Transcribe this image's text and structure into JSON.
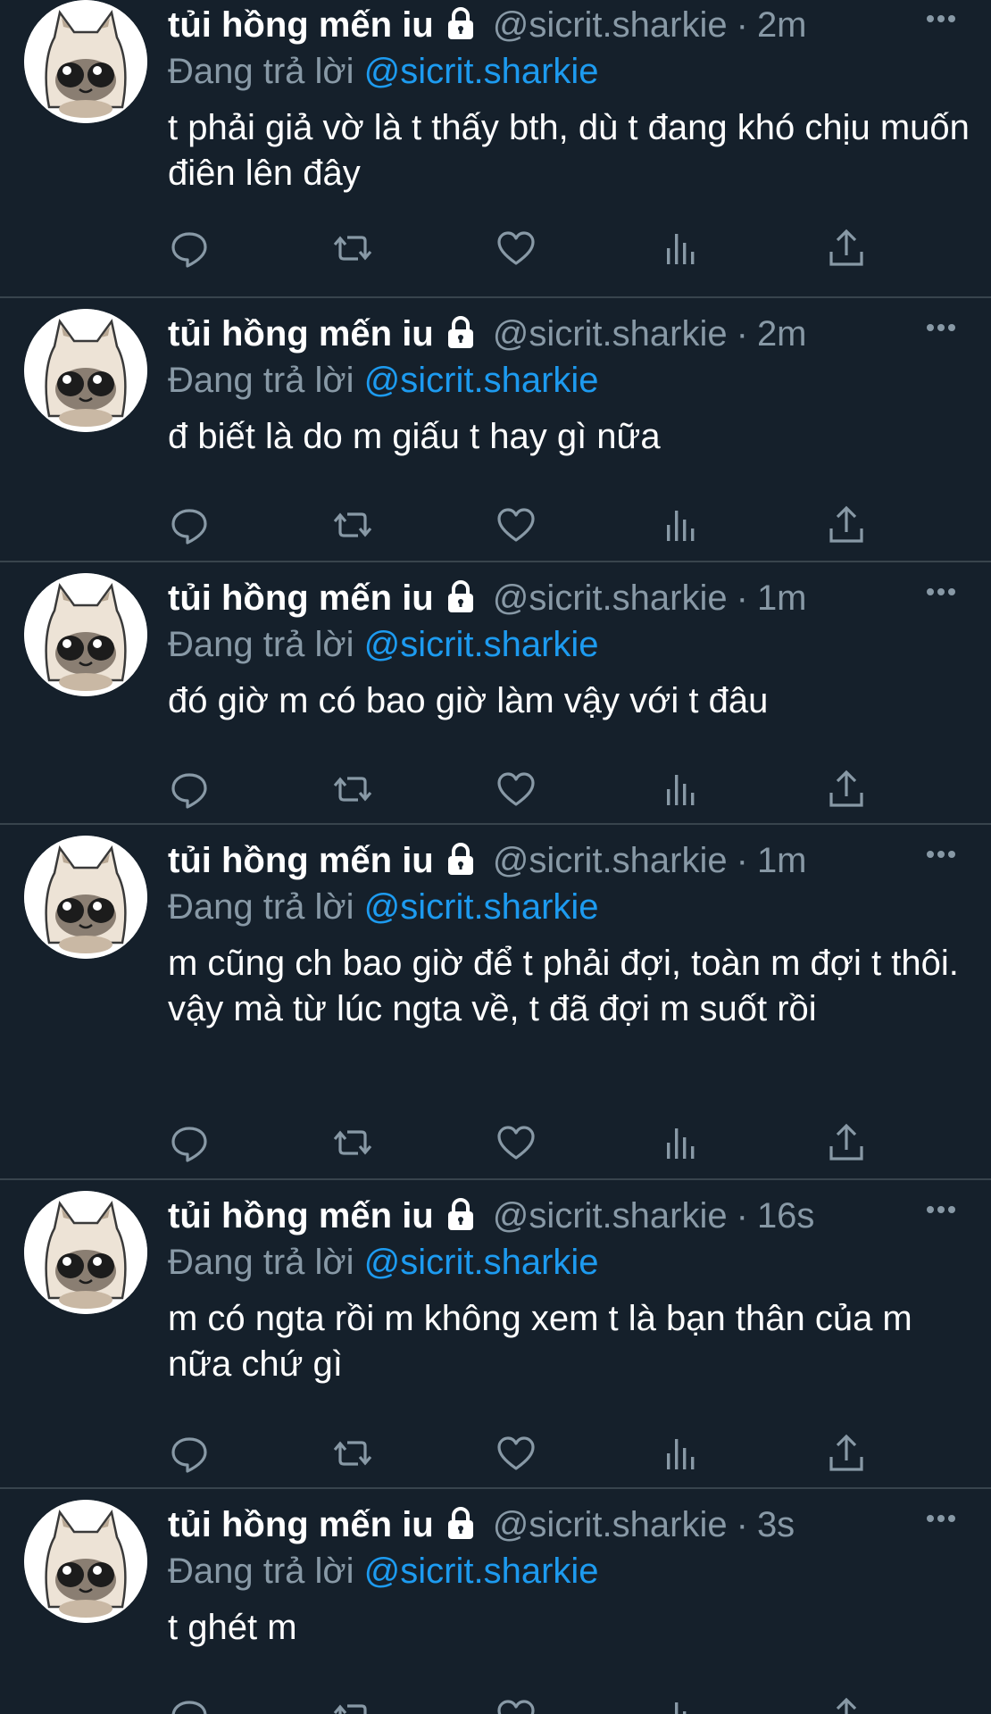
{
  "theme": {
    "background": "#15202b",
    "divider": "#38444d",
    "text": "#ffffff",
    "muted": "#8899a6",
    "link": "#1d9bf0"
  },
  "tweets": [
    {
      "display_name": "tủi hồng mến iu",
      "handle": "@sicrit.sharkie",
      "separator": "·",
      "time": "2m",
      "reply_prefix": "Đang trả lời",
      "reply_to": "@sicrit.sharkie",
      "text": "t phải giả vờ là t thấy bth, dù t đang khó chịu muốn điên lên đây"
    },
    {
      "display_name": "tủi hồng mến iu",
      "handle": "@sicrit.sharkie",
      "separator": "·",
      "time": "2m",
      "reply_prefix": "Đang trả lời",
      "reply_to": "@sicrit.sharkie",
      "text": "đ biết là do m giấu t hay gì nữa"
    },
    {
      "display_name": "tủi hồng mến iu",
      "handle": "@sicrit.sharkie",
      "separator": "·",
      "time": "1m",
      "reply_prefix": "Đang trả lời",
      "reply_to": "@sicrit.sharkie",
      "text": "đó giờ m có bao giờ làm vậy với t đâu"
    },
    {
      "display_name": "tủi hồng mến iu",
      "handle": "@sicrit.sharkie",
      "separator": "·",
      "time": "1m",
      "reply_prefix": "Đang trả lời",
      "reply_to": "@sicrit.sharkie",
      "text": "m cũng ch bao giờ để t phải đợi, toàn m đợi t thôi. vậy mà từ lúc ngta về, t đã đợi m suốt rồi"
    },
    {
      "display_name": "tủi hồng mến iu",
      "handle": "@sicrit.sharkie",
      "separator": "·",
      "time": "16s",
      "reply_prefix": "Đang trả lời",
      "reply_to": "@sicrit.sharkie",
      "text": "m có ngta rồi m không xem t là bạn thân của m nữa chứ gì"
    },
    {
      "display_name": "tủi hồng mến iu",
      "handle": "@sicrit.sharkie",
      "separator": "·",
      "time": "3s",
      "reply_prefix": "Đang trả lời",
      "reply_to": "@sicrit.sharkie",
      "text": "t ghét m"
    }
  ],
  "icons": {
    "avatar": "cat-avatar-icon",
    "lock": "lock-icon",
    "more": "more-dots-icon",
    "reply": "reply-icon",
    "retweet": "retweet-icon",
    "like": "heart-icon",
    "views": "views-icon",
    "share": "share-icon"
  }
}
